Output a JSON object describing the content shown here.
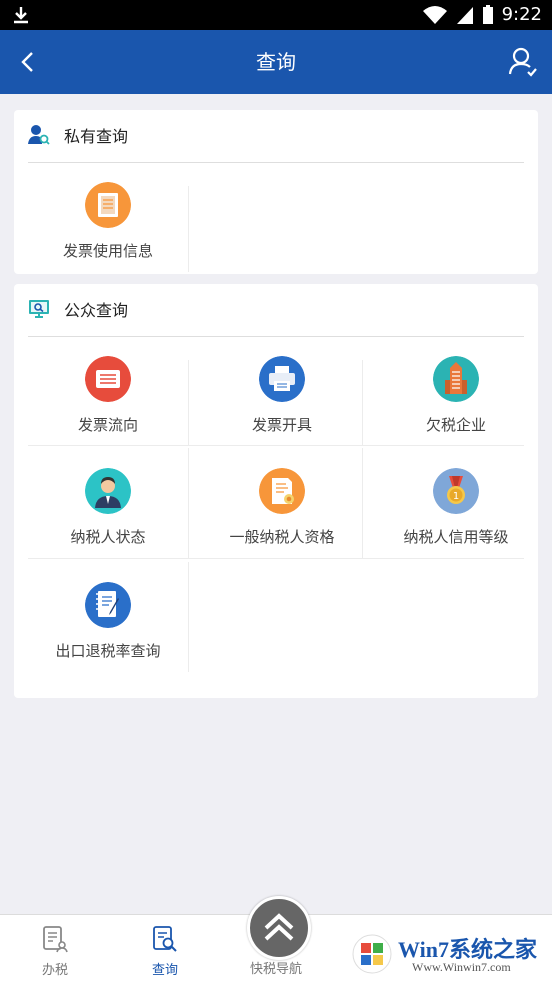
{
  "status_bar": {
    "time": "9:22"
  },
  "header": {
    "title": "查询"
  },
  "private_section": {
    "title": "私有查询",
    "items": [
      {
        "label": "发票使用信息",
        "icon": "invoice-usage-icon",
        "color": "#f7963a"
      }
    ]
  },
  "public_section": {
    "title": "公众查询",
    "items": [
      {
        "label": "发票流向",
        "icon": "invoice-flow-icon",
        "color": "#e74c3c"
      },
      {
        "label": "发票开具",
        "icon": "printer-icon",
        "color": "#2a6fc9"
      },
      {
        "label": "欠税企业",
        "icon": "building-icon",
        "color": "#2bb3b3"
      },
      {
        "label": "纳税人状态",
        "icon": "person-icon",
        "color": "#2cc3c6"
      },
      {
        "label": "一般纳税人资格",
        "icon": "certificate-icon",
        "color": "#f7963a"
      },
      {
        "label": "纳税人信用等级",
        "icon": "medal-icon",
        "color": "#7fa7d8"
      },
      {
        "label": "出口退税率查询",
        "icon": "notebook-icon",
        "color": "#2a6fc9"
      }
    ]
  },
  "tabbar": {
    "tabs": [
      {
        "label": "办税",
        "icon": "tax-doc-icon"
      },
      {
        "label": "查询",
        "icon": "search-doc-icon"
      },
      {
        "label": "快税导航",
        "icon": "double-chevron-up-icon"
      }
    ]
  },
  "watermark": {
    "logo_text": "Win7系统之家",
    "url_text": "Www.Winwin7.com"
  },
  "colors": {
    "primary": "#1a56ad",
    "background": "#efeff4"
  }
}
